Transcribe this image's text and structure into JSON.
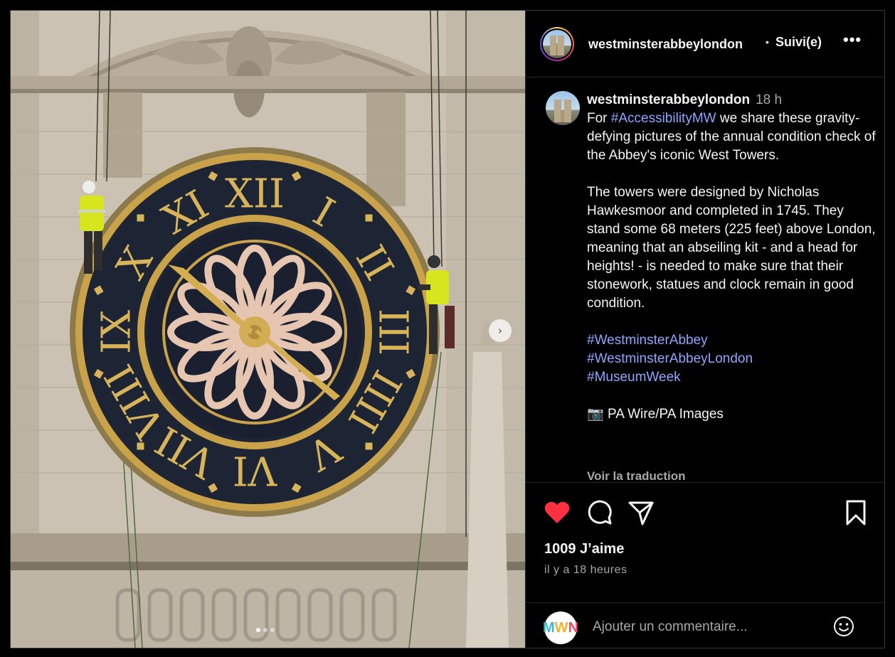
{
  "post": {
    "username_header": "westminsterabbeylondon",
    "separator": "•",
    "follow_label": "Suivi(e)",
    "more_label": "•••",
    "caption": {
      "username": "westminsterabbeylondon",
      "time": "18 h",
      "intro_prefix": "For ",
      "intro_tag": "#AccessibilityMW",
      "intro_rest": " we share these gravity-defying pictures of the annual condition check of the Abbey's iconic West Towers.",
      "body": "The towers were designed by Nicholas Hawkesmoor and completed in 1745. They stand some 68 meters (225 feet) above London, meaning that an abseiling kit - and a head for heights! - is needed to make sure that their stonework, statues and clock remain in good condition.",
      "hashtags": [
        "#WestminsterAbbey",
        "#WestminsterAbbeyLondon",
        "#MuseumWeek"
      ],
      "credit_icon": "📷",
      "credit": "PA Wire/PA Images"
    },
    "translate_label": "Voir la traduction",
    "likes_label": "1009 J’aime",
    "time_ago": "il y a 18 heures",
    "comment_placeholder": "Ajouter un commentaire...",
    "commenter_avatar_letters": [
      "M",
      "W",
      "N"
    ],
    "carousel": {
      "slides": 3,
      "active": 0,
      "next_icon": "›"
    },
    "colors": {
      "like": "#ff3040",
      "hashtag": "#8ea6ff",
      "secondary": "#a8a8a8"
    }
  },
  "clock_numerals": [
    "XII",
    "I",
    "II",
    "III",
    "IIII",
    "V",
    "VI",
    "VII",
    "VIII",
    "IX",
    "X",
    "XI"
  ]
}
